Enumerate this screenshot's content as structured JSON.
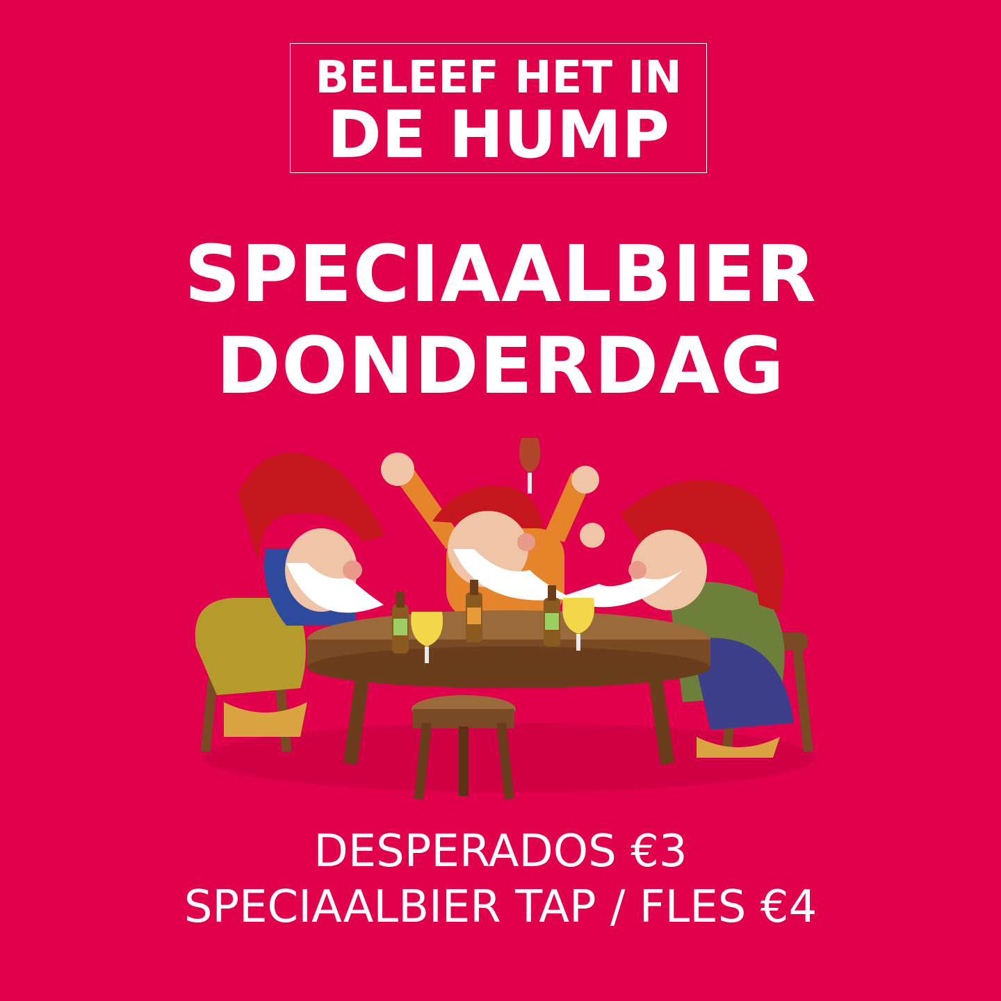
{
  "logo": {
    "line1": "BELEEF HET IN",
    "line2": "DE HUMP"
  },
  "headline": {
    "line1": "SPECIAALBIER",
    "line2": "DONDERDAG"
  },
  "illustration": {
    "icon": "gnomes-drinking-beer-illustration"
  },
  "prices": [
    "DESPERADOS €3",
    "SPECIAALBIER TAP / FLES €4"
  ],
  "colors": {
    "background": "#E0004B",
    "text": "#FFFFFF"
  }
}
